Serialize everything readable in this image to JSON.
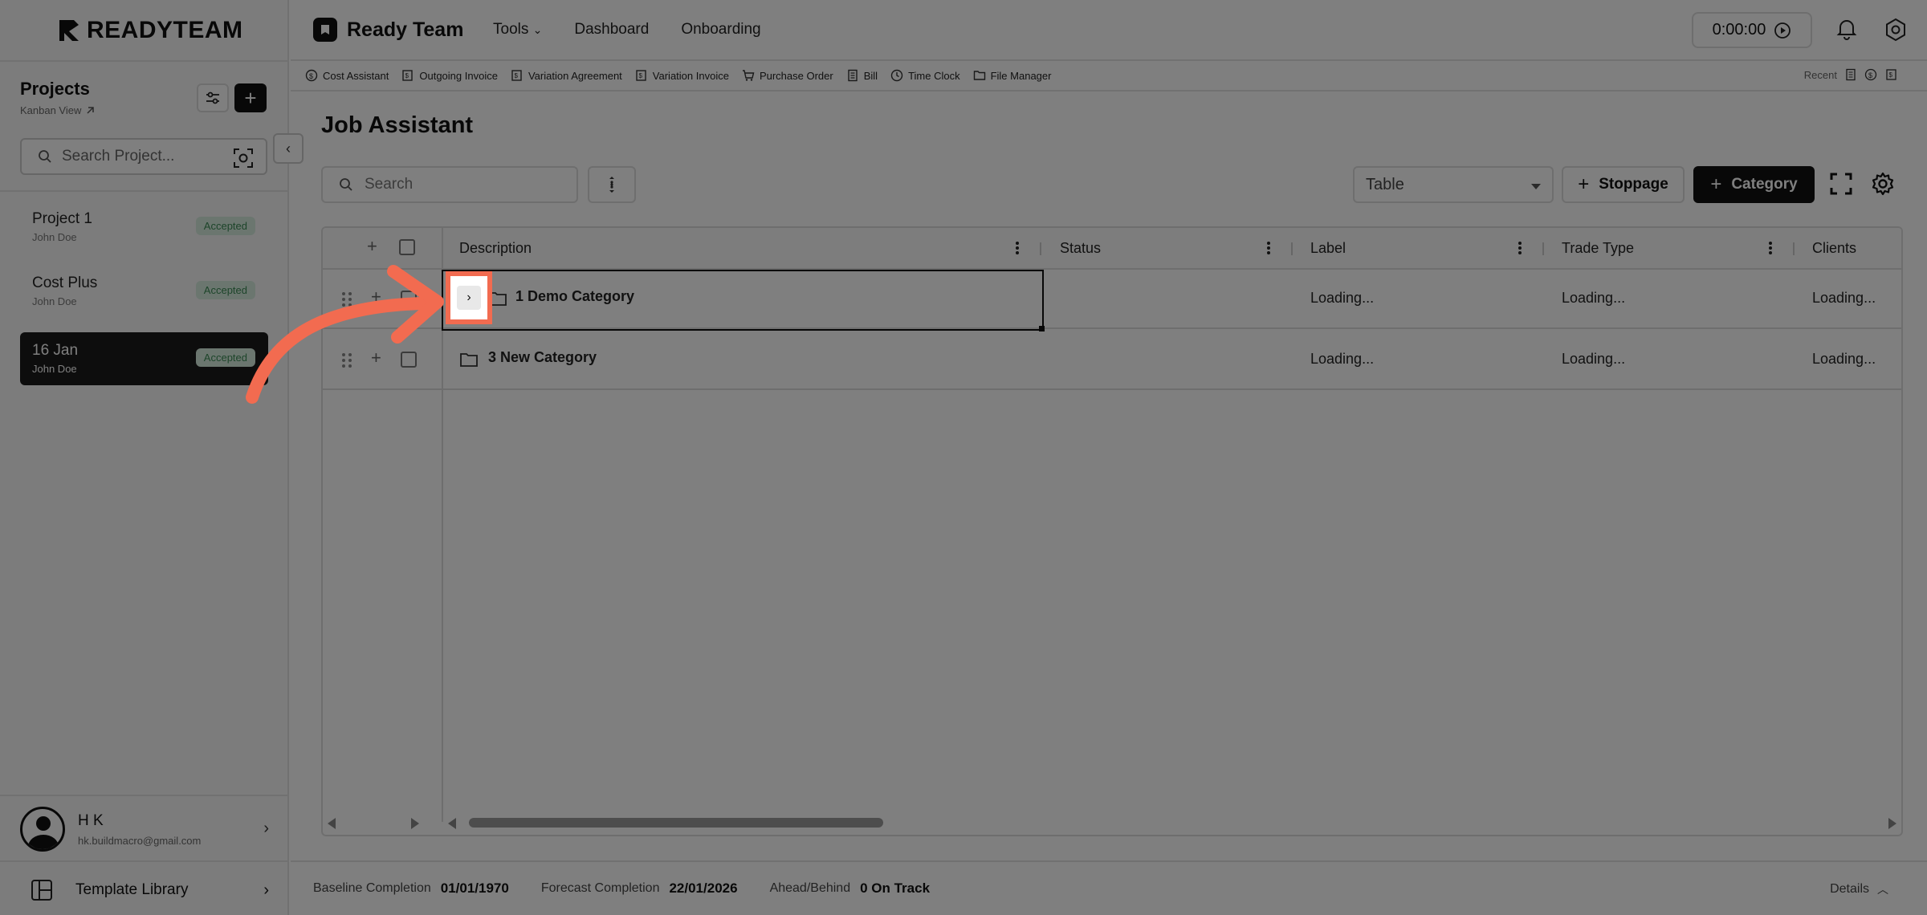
{
  "sidebar": {
    "logo": "READYTEAM",
    "projects_title": "Projects",
    "kanban_link": "Kanban View",
    "search_placeholder": "Search Project...",
    "projects": [
      {
        "name": "Project 1",
        "owner": "John Doe",
        "status": "Accepted"
      },
      {
        "name": "Cost Plus",
        "owner": "John Doe",
        "status": "Accepted"
      },
      {
        "name": "16 Jan",
        "owner": "John Doe",
        "status": "Accepted"
      }
    ],
    "user": {
      "name": "H K",
      "email": "hk.buildmacro@gmail.com"
    },
    "template_library": "Template Library"
  },
  "header": {
    "brand": "Ready Team",
    "nav": [
      "Tools",
      "Dashboard",
      "Onboarding"
    ],
    "timer": "0:00:00"
  },
  "toolstrip": {
    "items": [
      "Cost Assistant",
      "Outgoing Invoice",
      "Variation Agreement",
      "Variation Invoice",
      "Purchase Order",
      "Bill",
      "Time Clock",
      "File Manager"
    ],
    "recent_label": "Recent"
  },
  "main": {
    "title": "Job Assistant",
    "search_placeholder": "Search",
    "view_select": "Table",
    "stoppage_label": "Stoppage",
    "category_label": "Category",
    "columns": [
      "Description",
      "Status",
      "Label",
      "Trade Type",
      "Clients"
    ],
    "rows": [
      {
        "name": "1 Demo Category",
        "status": "",
        "label": "Loading...",
        "trade_type": "Loading...",
        "clients": "Loading..."
      },
      {
        "name": "3 New Category",
        "status": "",
        "label": "Loading...",
        "trade_type": "Loading...",
        "clients": "Loading..."
      }
    ]
  },
  "footer": {
    "baseline_label": "Baseline Completion",
    "baseline_value": "01/01/1970",
    "forecast_label": "Forecast Completion",
    "forecast_value": "22/01/2026",
    "ahead_label": "Ahead/Behind",
    "ahead_value": "0 On Track",
    "details_label": "Details"
  },
  "colors": {
    "accent_overlay": "#f26b50",
    "badge_bg": "#d7ecdf",
    "badge_text": "#3a8a55"
  }
}
